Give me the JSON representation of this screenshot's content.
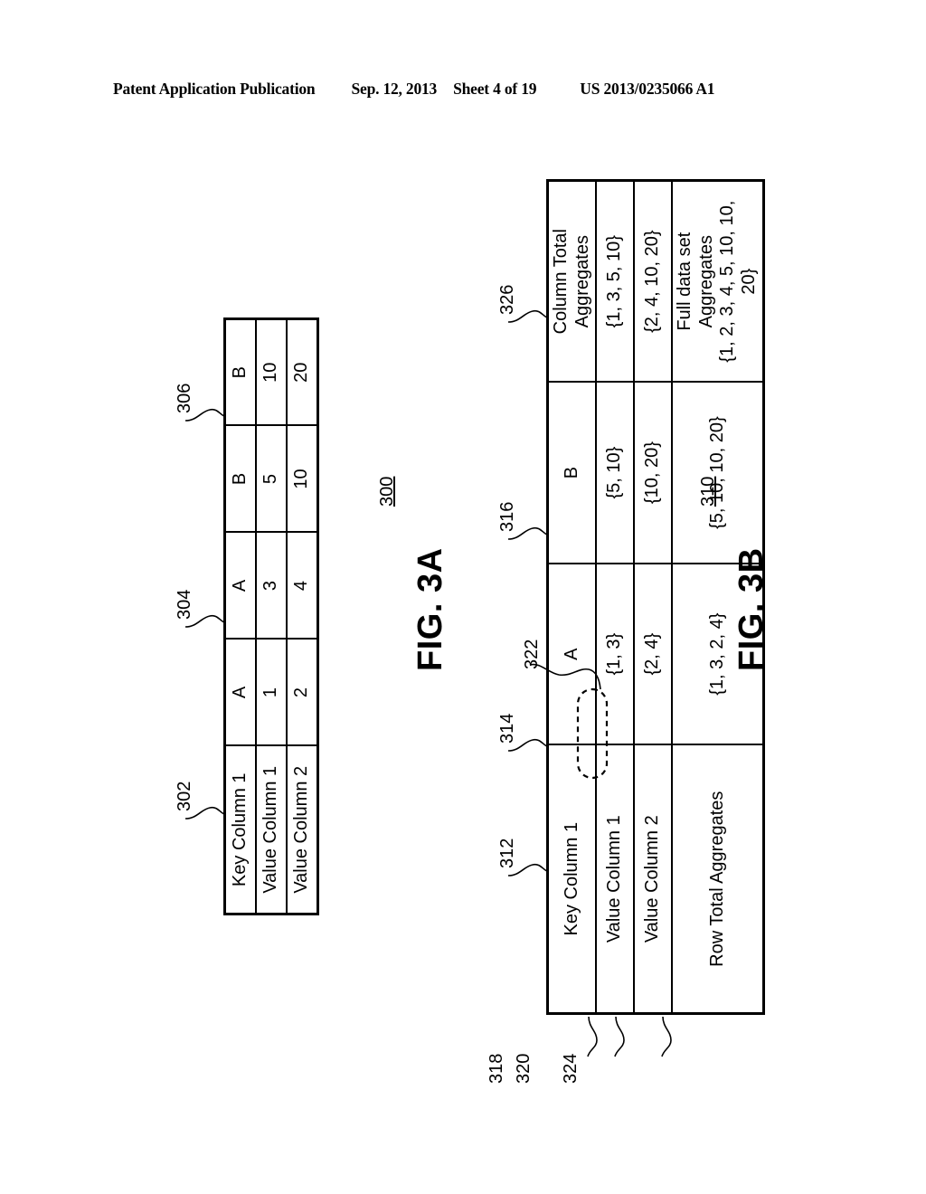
{
  "header": {
    "publication": "Patent Application Publication",
    "date": "Sep. 12, 2013",
    "sheet": "Sheet 4 of 19",
    "patent_number": "US 2013/0235066 A1"
  },
  "figures": [
    {
      "caption": "FIG. 3A",
      "figure_number": "300",
      "table": {
        "columns": [
          "Key Column 1",
          "Value Column 1",
          "Value Column 2"
        ],
        "rows": [
          [
            "A",
            "1",
            "2"
          ],
          [
            "A",
            "3",
            "4"
          ],
          [
            "B",
            "5",
            "10"
          ],
          [
            "B",
            "10",
            "20"
          ]
        ]
      },
      "reference_numerals": [
        {
          "id": "302",
          "target": "Key Column 1 header"
        },
        {
          "id": "304",
          "target": "Value Column 1 header"
        },
        {
          "id": "306",
          "target": "Value Column 2 header"
        }
      ]
    },
    {
      "caption": "FIG. 3B",
      "figure_number": "310",
      "table": {
        "columns": [
          "Key Column 1",
          "Value Column 1",
          "Value Column 2",
          "Row Total Aggregates"
        ],
        "rows": [
          [
            "A",
            "{1, 3}",
            "{2, 4}",
            "{1, 3, 2, 4}"
          ],
          [
            "B",
            "{5, 10}",
            "{10, 20}",
            "{5, 10, 10, 20}"
          ],
          [
            "Column Total\nAggregates",
            "{1, 3, 5, 10}",
            "{2, 4, 10, 20}",
            "Full data set Aggregates\n{1, 2, 3, 4, 5, 10, 10, 20}"
          ]
        ],
        "footer_row_label_line1": "Column Total",
        "footer_row_label_line2": "Aggregates",
        "corner_cell_line1": "Full data set Aggregates",
        "corner_cell_line2": "{1, 2, 3, 4, 5, 10, 10, 20}"
      },
      "reference_numerals": [
        {
          "id": "312",
          "target": "Key Column 1 header"
        },
        {
          "id": "314",
          "target": "Value Column 1 header"
        },
        {
          "id": "316",
          "target": "Value Column 2 header"
        },
        {
          "id": "322",
          "target": "highlighted aggregate cell {1, 3}"
        },
        {
          "id": "326",
          "target": "Row Total Aggregates header"
        },
        {
          "id": "318",
          "target": "row A"
        },
        {
          "id": "320",
          "target": "row B"
        },
        {
          "id": "324",
          "target": "Column Total Aggregates row"
        }
      ],
      "highlight": {
        "cell_value": "{1, 3}",
        "style": "dashed-oval"
      }
    }
  ]
}
